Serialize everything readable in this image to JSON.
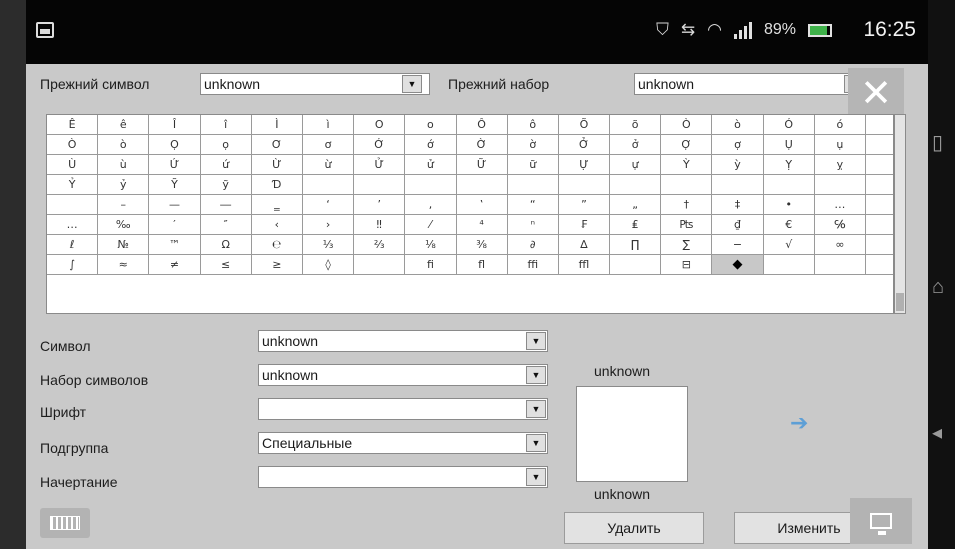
{
  "status_bar": {
    "battery_text": "89%",
    "time": "16:25"
  },
  "top": {
    "prev_symbol_label": "Прежний символ",
    "prev_symbol_value": "unknown",
    "prev_set_label": "Прежний набор",
    "prev_set_value": "unknown"
  },
  "grid": {
    "rows": [
      [
        "Ê",
        "ê",
        "Î",
        "î",
        "Ì",
        "ì",
        "O",
        "o",
        "Ô",
        "ô",
        "Õ",
        "õ",
        "Ò",
        "ò",
        "Ó",
        "ó"
      ],
      [
        "Ò",
        "ò",
        "Ọ",
        "ọ",
        "Ơ",
        "ơ",
        "Ớ",
        "ớ",
        "Ờ",
        "ờ",
        "Ở",
        "ở",
        "Ợ",
        "ợ",
        "Ụ",
        "ụ"
      ],
      [
        "Ù",
        "ù",
        "Ứ",
        "ứ",
        "Ừ",
        "ừ",
        "Ử",
        "ử",
        "Ữ",
        "ữ",
        "Ự",
        "ự",
        "Ỳ",
        "ỳ",
        "Ỵ",
        "ỵ"
      ],
      [
        "Ỷ",
        "ỷ",
        "Ỹ",
        "ỹ",
        "Ɗ",
        "",
        "",
        "",
        "",
        "",
        "",
        "",
        "",
        "",
        "",
        ""
      ],
      [
        "",
        "–",
        "—",
        "―",
        "‗",
        "‘",
        "’",
        "‚",
        "‛",
        "“",
        "”",
        "„",
        "†",
        "‡",
        "•",
        "…"
      ],
      [
        "…",
        "‰",
        "′",
        "″",
        "‹",
        "›",
        "‼",
        "⁄",
        "⁴",
        "ⁿ",
        "₣",
        "₤",
        "₧",
        "₫",
        "€",
        "℅"
      ],
      [
        "ℓ",
        "№",
        "™",
        "Ω",
        "℮",
        "⅓",
        "⅔",
        "⅛",
        "⅜",
        "∂",
        "∆",
        "∏",
        "∑",
        "−",
        "√",
        "∞"
      ],
      [
        "∫",
        "≈",
        "≠",
        "≤",
        "≥",
        "◊",
        "",
        "ﬁ",
        "ﬂ",
        "ﬃ",
        "ﬄ",
        "",
        "⊟",
        "◆",
        "",
        ""
      ]
    ],
    "selected_glyph": "◆"
  },
  "form": {
    "symbol_label": "Символ",
    "symbol_value": "unknown",
    "charset_label": "Набор символов",
    "charset_value": "unknown",
    "font_label": "Шрифт",
    "font_value": "",
    "subgroup_label": "Подгруппа",
    "subgroup_value": "Специальные",
    "style_label": "Начертание",
    "style_value": ""
  },
  "preview": {
    "top_label": "unknown",
    "bottom_label": "unknown"
  },
  "buttons": {
    "delete": "Удалить",
    "modify": "Изменить"
  },
  "colors": {
    "accent_arrow": "#5d9fd6",
    "battery": "#3fb24a"
  },
  "icons": [
    "image-icon",
    "shield-icon",
    "sync-icon",
    "wifi-icon",
    "signal-icon",
    "battery-icon",
    "close-icon",
    "arrow-right-icon",
    "keyboard-icon",
    "display-icon"
  ]
}
